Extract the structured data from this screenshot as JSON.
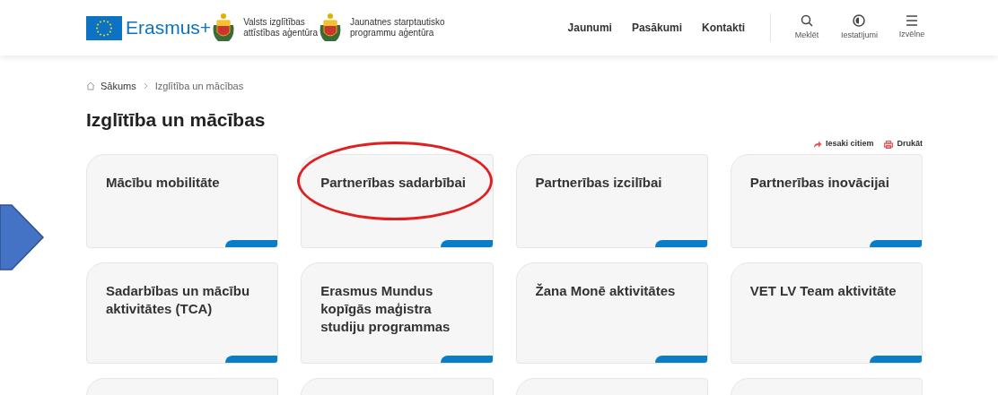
{
  "header": {
    "logo": {
      "text": "Erasmus+"
    },
    "agencies": [
      {
        "line1": "Valsts izglītības",
        "line2": "attīstības aģentūra"
      },
      {
        "line1": "Jaunatnes starptautisko",
        "line2": "programmu aģentūra"
      }
    ],
    "nav": [
      "Jaunumi",
      "Pasākumi",
      "Kontakti"
    ],
    "tools": [
      {
        "kind": "search",
        "label": "Meklēt"
      },
      {
        "kind": "contrast",
        "label": "Iestatījumi"
      },
      {
        "kind": "menu",
        "label": "Izvēlne"
      }
    ]
  },
  "breadcrumb": [
    "Sākums",
    "Izglītība un mācības"
  ],
  "title": "Izglītība un mācības",
  "actions": [
    {
      "kind": "share",
      "label": "Iesaki citiem"
    },
    {
      "kind": "print",
      "label": "Drukāt"
    }
  ],
  "cards": [
    {
      "kind": "card",
      "title": "Mācību mobilitāte",
      "highlighted": false
    },
    {
      "kind": "card",
      "title": "Partnerības sadarbībai",
      "highlighted": true
    },
    {
      "kind": "card",
      "title": "Partnerības izcilībai",
      "highlighted": false
    },
    {
      "kind": "card",
      "title": "Partnerības inovācijai",
      "highlighted": false
    },
    {
      "kind": "card",
      "title": "Sadarbības un mācību aktivitātes (TCA)",
      "highlighted": false
    },
    {
      "kind": "card",
      "title": "Erasmus Mundus kopīgās maģistra studiju programmas",
      "highlighted": false
    },
    {
      "kind": "card",
      "title": "Žana Monē aktivitātes",
      "highlighted": false
    },
    {
      "kind": "card",
      "title": "VET LV Team aktivitāte",
      "highlighted": false
    },
    {
      "kind": "cut_off"
    },
    {
      "kind": "cut_off"
    },
    {
      "kind": "cut_off"
    },
    {
      "kind": "cut_off"
    }
  ]
}
